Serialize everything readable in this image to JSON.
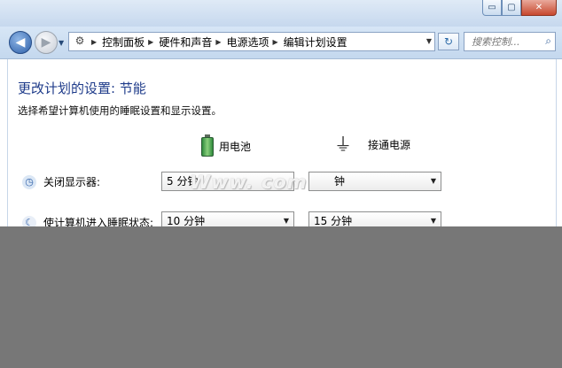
{
  "window": {
    "caption_buttons": {
      "minimize": "▭",
      "maximize": "▢",
      "close": "✕"
    }
  },
  "nav": {
    "back_glyph": "◀",
    "forward_glyph": "▶",
    "breadcrumbs": [
      "控制面板",
      "硬件和声音",
      "电源选项",
      "编辑计划设置"
    ],
    "search_placeholder": "搜索控制...",
    "refresh_glyph": "↻"
  },
  "main": {
    "title": "更改计划的设置: 节能",
    "subtitle": "选择希望计算机使用的睡眠设置和显示设置。",
    "columns": {
      "battery_label": "用电池",
      "plugged_label": "接通电源"
    },
    "rows": [
      {
        "label": "关闭显示器:",
        "battery_value": "5 分钟",
        "plugged_value": "钟",
        "icon": "monitor-clock-icon"
      },
      {
        "label": "使计算机进入睡眠状态:",
        "battery_value": "10 分钟",
        "plugged_value": "15 分钟",
        "icon": "moon-sleep-icon"
      }
    ],
    "watermark": "Www.          com"
  },
  "colors": {
    "title": "#1e3b8a",
    "background_gray": "#777777",
    "navbar": "#c4d8ee"
  }
}
